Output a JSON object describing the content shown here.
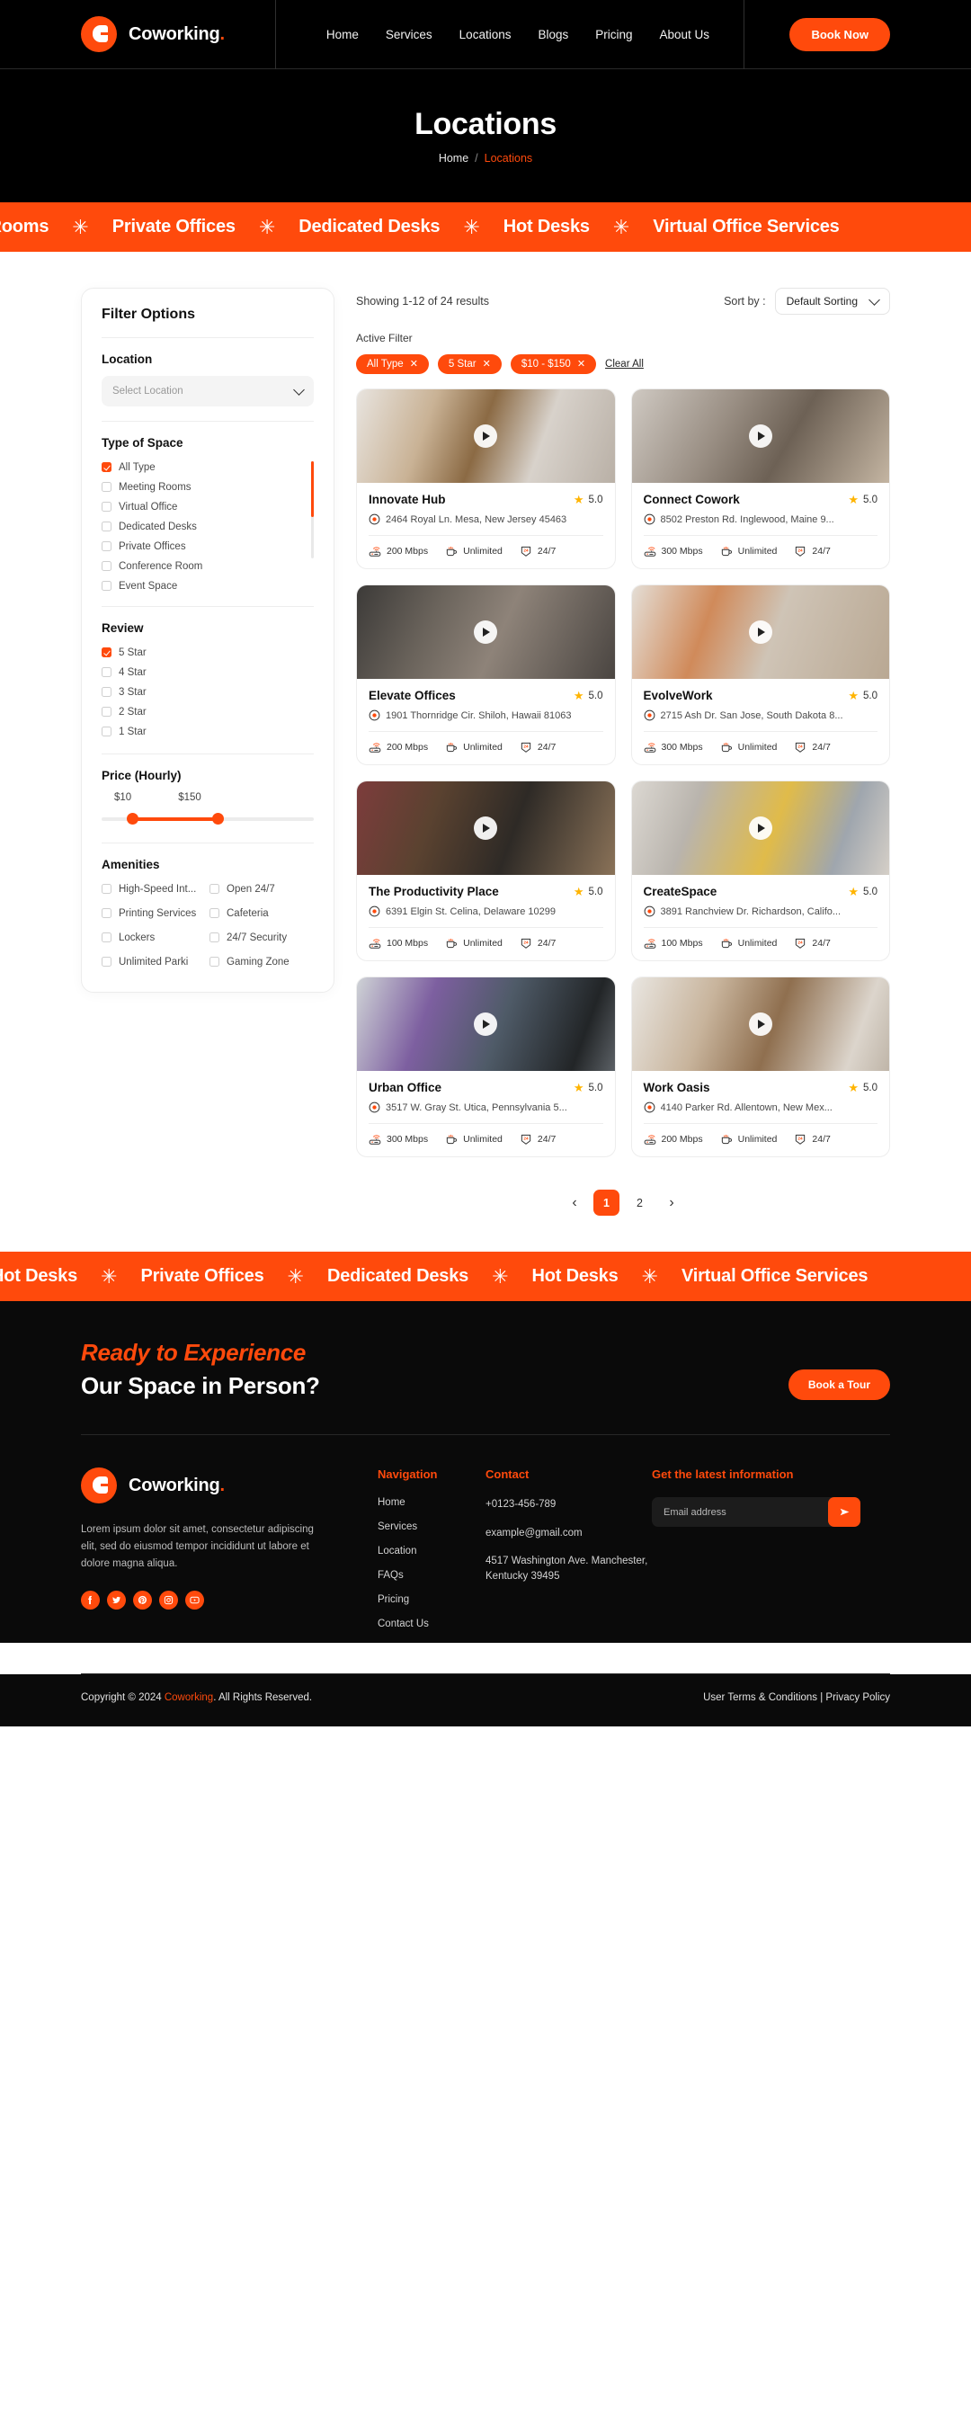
{
  "header": {
    "brand": "Coworking",
    "brand_dot": ".",
    "nav": [
      {
        "label": "Home"
      },
      {
        "label": "Services"
      },
      {
        "label": "Locations"
      },
      {
        "label": "Blogs"
      },
      {
        "label": "Pricing"
      },
      {
        "label": "About Us"
      }
    ],
    "cta_label": "Book Now"
  },
  "hero": {
    "title": "Locations",
    "breadcrumb_home": "Home",
    "breadcrumb_sep": "/",
    "breadcrumb_current": "Locations"
  },
  "marquee": {
    "items": [
      "Meeting Rooms",
      "Private Offices",
      "Dedicated Desks",
      "Hot Desks",
      "Virtual Office Services"
    ],
    "separator": "✳"
  },
  "sidebar": {
    "title": "Filter Options",
    "location": {
      "label": "Location",
      "placeholder": "Select Location",
      "value": ""
    },
    "type_of_space": {
      "label": "Type of Space",
      "options": [
        {
          "label": "All Type",
          "checked": true
        },
        {
          "label": "Meeting Rooms",
          "checked": false
        },
        {
          "label": "Virtual Office",
          "checked": false
        },
        {
          "label": "Dedicated Desks",
          "checked": false
        },
        {
          "label": "Private Offices",
          "checked": false
        },
        {
          "label": "Conference Room",
          "checked": false
        },
        {
          "label": "Event Space",
          "checked": false
        }
      ]
    },
    "review": {
      "label": "Review",
      "options": [
        {
          "label": "5 Star",
          "checked": true
        },
        {
          "label": "4 Star",
          "checked": false
        },
        {
          "label": "3 Star",
          "checked": false
        },
        {
          "label": "2 Star",
          "checked": false
        },
        {
          "label": "1 Star",
          "checked": false
        }
      ]
    },
    "price": {
      "label": "Price (Hourly)",
      "min_label": "$10",
      "max_label": "$150"
    },
    "amenities": {
      "label": "Amenities",
      "options": [
        {
          "label": "High-Speed Int...",
          "checked": false
        },
        {
          "label": "Open 24/7",
          "checked": false
        },
        {
          "label": "Printing Services",
          "checked": false
        },
        {
          "label": "Cafeteria",
          "checked": false
        },
        {
          "label": "Lockers",
          "checked": false
        },
        {
          "label": "24/7 Security",
          "checked": false
        },
        {
          "label": "Unlimited Parki",
          "checked": false
        },
        {
          "label": "Gaming Zone",
          "checked": false
        }
      ]
    }
  },
  "results": {
    "count_text": "Showing 1-12 of 24 results",
    "sort_label": "Sort by :",
    "sort_value": "Default Sorting",
    "active_filter_label": "Active Filter",
    "chips": [
      {
        "label": "All Type"
      },
      {
        "label": "5 Star"
      },
      {
        "label": "$10 - $150"
      }
    ],
    "clear_all": "Clear All",
    "cards": [
      {
        "title": "Innovate Hub",
        "rating": "5.0",
        "address": "2464 Royal Ln. Mesa, New Jersey 45463",
        "speed": "200 Mbps",
        "coffee": "Unlimited",
        "hours": "24/7"
      },
      {
        "title": "Connect Cowork",
        "rating": "5.0",
        "address": "8502 Preston Rd. Inglewood, Maine 9...",
        "speed": "300 Mbps",
        "coffee": "Unlimited",
        "hours": "24/7"
      },
      {
        "title": "Elevate Offices",
        "rating": "5.0",
        "address": "1901 Thornridge Cir. Shiloh, Hawaii 81063",
        "speed": "200 Mbps",
        "coffee": "Unlimited",
        "hours": "24/7"
      },
      {
        "title": "EvolveWork",
        "rating": "5.0",
        "address": "2715 Ash Dr. San Jose, South Dakota 8...",
        "speed": "300 Mbps",
        "coffee": "Unlimited",
        "hours": "24/7"
      },
      {
        "title": "The Productivity Place",
        "rating": "5.0",
        "address": "6391 Elgin St. Celina, Delaware 10299",
        "speed": "100 Mbps",
        "coffee": "Unlimited",
        "hours": "24/7"
      },
      {
        "title": "CreateSpace",
        "rating": "5.0",
        "address": "3891 Ranchview Dr. Richardson, Califo...",
        "speed": "100 Mbps",
        "coffee": "Unlimited",
        "hours": "24/7"
      },
      {
        "title": "Urban Office",
        "rating": "5.0",
        "address": "3517 W. Gray St. Utica, Pennsylvania 5...",
        "speed": "300 Mbps",
        "coffee": "Unlimited",
        "hours": "24/7"
      },
      {
        "title": "Work Oasis",
        "rating": "5.0",
        "address": "4140 Parker Rd. Allentown, New Mex...",
        "speed": "200 Mbps",
        "coffee": "Unlimited",
        "hours": "24/7"
      }
    ],
    "pagination": {
      "prev": "‹",
      "pages": [
        "1",
        "2"
      ],
      "active": "1",
      "next": "›"
    }
  },
  "cta": {
    "line1": "Ready to Experience",
    "line2": "Our Space in Person?",
    "button": "Book a Tour"
  },
  "footer": {
    "brand": "Coworking",
    "brand_dot": ".",
    "about": "Lorem ipsum dolor sit amet, consectetur adipiscing elit, sed do eiusmod tempor incididunt ut labore et dolore magna aliqua.",
    "socials": [
      "facebook-icon",
      "twitter-icon",
      "pinterest-icon",
      "instagram-icon",
      "youtube-icon"
    ],
    "nav_heading": "Navigation",
    "nav_links": [
      "Home",
      "Services",
      "Location",
      "FAQs",
      "Pricing",
      "Contact Us"
    ],
    "contact_heading": "Contact",
    "contact_phone": "+0123-456-789",
    "contact_email": "example@gmail.com",
    "contact_address": "4517 Washington Ave. Manchester, Kentucky 39495",
    "newsletter_heading": "Get the latest information",
    "newsletter_placeholder": "Email address",
    "newsletter_value": "",
    "copyright_pre": "Copyright © 2024 ",
    "copyright_brand": "Coworking",
    "copyright_post": ". All Rights Reserved.",
    "legal": "User Terms & Conditions | Privacy Policy"
  },
  "colors": {
    "accent": "#FF4A0C",
    "dark": "#000000",
    "star": "#FFB400"
  }
}
